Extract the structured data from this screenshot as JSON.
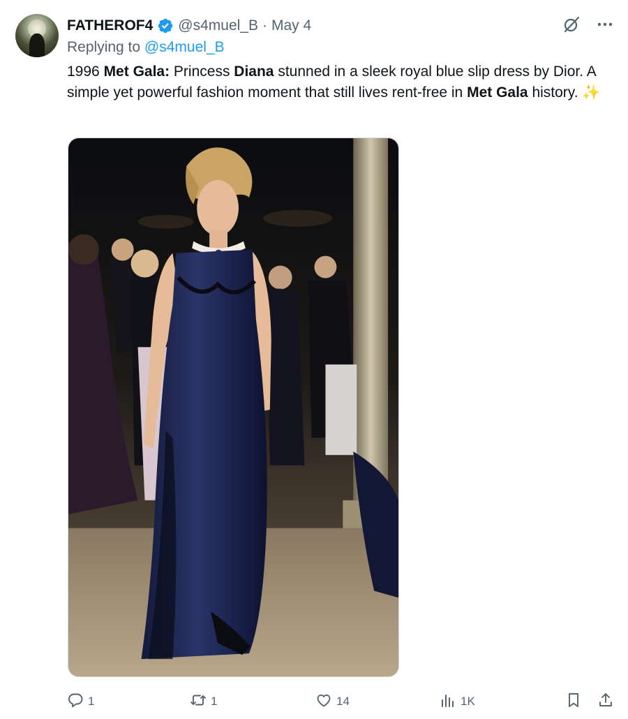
{
  "tweet": {
    "display_name": "FATHEROF4",
    "handle": "@s4muel_B",
    "separator": "·",
    "date": "May 4",
    "replying_prefix": "Replying to",
    "replying_handle": "@s4muel_B",
    "text_parts": {
      "p1": "1996 ",
      "b1": "Met Gala:",
      "p2": " Princess ",
      "b2": "Diana",
      "p3": " stunned in a sleek royal blue slip dress by Dior. A simple yet powerful fashion moment that still lives rent-free in ",
      "b3": "Met Gala",
      "p4": " history. ",
      "emoji": "✨"
    },
    "media_alt": "Princess Diana in a navy satin slip dress at the 1996 Met Gala"
  },
  "actions": {
    "replies": "1",
    "reposts": "1",
    "likes": "14",
    "views": "1K"
  },
  "colors": {
    "verified": "#1d9bf0",
    "link": "#1d9bf0",
    "muted": "#536471",
    "text": "#0f1419"
  },
  "icons": {
    "verified": "verified-badge-icon",
    "grok": "grok-icon",
    "more": "more-icon",
    "reply": "reply-icon",
    "repost": "repost-icon",
    "like": "like-icon",
    "views": "views-icon",
    "bookmark": "bookmark-icon",
    "share": "share-icon"
  }
}
